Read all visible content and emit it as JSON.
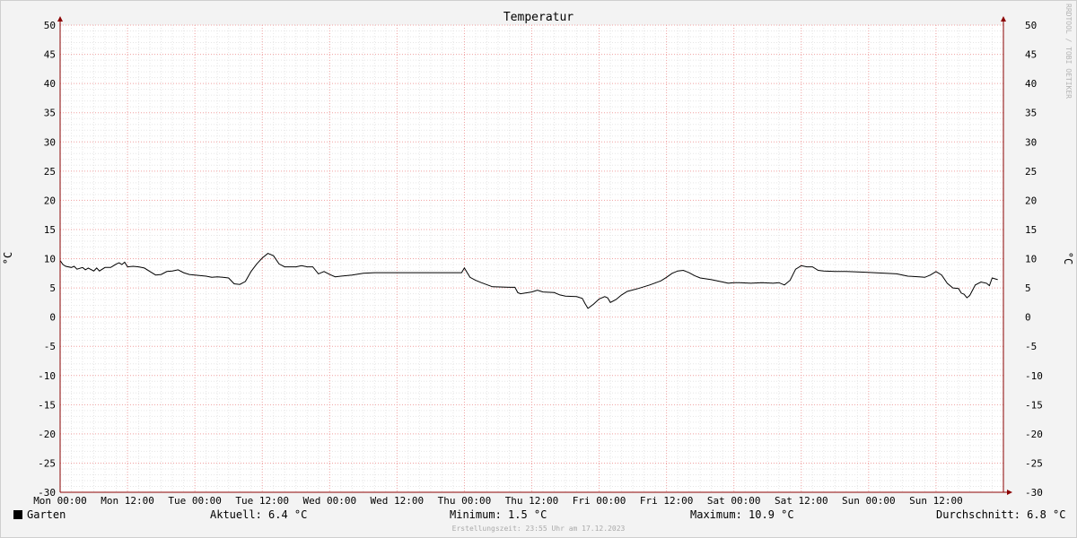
{
  "chart_data": {
    "type": "line",
    "title": "Temperatur",
    "ylabel": "°C",
    "ylabel_right": "°C",
    "ylim": [
      -30,
      50
    ],
    "yticks": [
      50,
      45,
      40,
      35,
      30,
      25,
      20,
      15,
      10,
      5,
      0,
      -5,
      -10,
      -15,
      -20,
      -25,
      -30
    ],
    "xlim_hours": [
      0,
      168
    ],
    "xticks": [
      {
        "label": "Mon 00:00",
        "hour": 0
      },
      {
        "label": "Mon 12:00",
        "hour": 12
      },
      {
        "label": "Tue 00:00",
        "hour": 24
      },
      {
        "label": "Tue 12:00",
        "hour": 36
      },
      {
        "label": "Wed 00:00",
        "hour": 48
      },
      {
        "label": "Wed 12:00",
        "hour": 60
      },
      {
        "label": "Thu 00:00",
        "hour": 72
      },
      {
        "label": "Thu 12:00",
        "hour": 84
      },
      {
        "label": "Fri 00:00",
        "hour": 96
      },
      {
        "label": "Fri 12:00",
        "hour": 108
      },
      {
        "label": "Sat 00:00",
        "hour": 120
      },
      {
        "label": "Sat 12:00",
        "hour": 132
      },
      {
        "label": "Sun 00:00",
        "hour": 144
      },
      {
        "label": "Sun 12:00",
        "hour": 156
      }
    ],
    "series": [
      {
        "name": "Garten",
        "color": "#000000",
        "points": [
          [
            0,
            9.7
          ],
          [
            0.5,
            9.0
          ],
          [
            1,
            8.7
          ],
          [
            2,
            8.5
          ],
          [
            2.5,
            8.7
          ],
          [
            3,
            8.2
          ],
          [
            4,
            8.5
          ],
          [
            4.5,
            8.1
          ],
          [
            5,
            8.4
          ],
          [
            6,
            7.9
          ],
          [
            6.5,
            8.4
          ],
          [
            7,
            7.9
          ],
          [
            8,
            8.5
          ],
          [
            9,
            8.5
          ],
          [
            10,
            9.1
          ],
          [
            10.5,
            9.3
          ],
          [
            11,
            9.0
          ],
          [
            11.5,
            9.4
          ],
          [
            12,
            8.6
          ],
          [
            13,
            8.7
          ],
          [
            14,
            8.6
          ],
          [
            15,
            8.4
          ],
          [
            16,
            7.8
          ],
          [
            17,
            7.2
          ],
          [
            18,
            7.3
          ],
          [
            19,
            7.8
          ],
          [
            20,
            7.9
          ],
          [
            21,
            8.1
          ],
          [
            22,
            7.6
          ],
          [
            23,
            7.3
          ],
          [
            24,
            7.2
          ],
          [
            25,
            7.1
          ],
          [
            26,
            7.0
          ],
          [
            27,
            6.8
          ],
          [
            28,
            6.9
          ],
          [
            29,
            6.8
          ],
          [
            30,
            6.7
          ],
          [
            31,
            5.7
          ],
          [
            32,
            5.6
          ],
          [
            33,
            6.1
          ],
          [
            34,
            7.8
          ],
          [
            35,
            9.1
          ],
          [
            36,
            10.1
          ],
          [
            37,
            10.9
          ],
          [
            38,
            10.5
          ],
          [
            39,
            9.1
          ],
          [
            40,
            8.6
          ],
          [
            42,
            8.6
          ],
          [
            43,
            8.8
          ],
          [
            44,
            8.6
          ],
          [
            45,
            8.6
          ],
          [
            46,
            7.4
          ],
          [
            47,
            7.8
          ],
          [
            48,
            7.3
          ],
          [
            49,
            6.9
          ],
          [
            50,
            7.0
          ],
          [
            52,
            7.2
          ],
          [
            54,
            7.5
          ],
          [
            56,
            7.6
          ],
          [
            60,
            7.6
          ],
          [
            64,
            7.6
          ],
          [
            70,
            7.6
          ],
          [
            71.5,
            7.6
          ],
          [
            72,
            8.4
          ],
          [
            73,
            6.8
          ],
          [
            74,
            6.3
          ],
          [
            75,
            5.9
          ],
          [
            77,
            5.2
          ],
          [
            80,
            5.1
          ],
          [
            81,
            5.1
          ],
          [
            81.5,
            4.2
          ],
          [
            82,
            4.0
          ],
          [
            84,
            4.3
          ],
          [
            85,
            4.6
          ],
          [
            86,
            4.3
          ],
          [
            88,
            4.2
          ],
          [
            89,
            3.8
          ],
          [
            90,
            3.6
          ],
          [
            92,
            3.5
          ],
          [
            93,
            3.2
          ],
          [
            93.5,
            2.3
          ],
          [
            94,
            1.5
          ],
          [
            95,
            2.2
          ],
          [
            96,
            3.1
          ],
          [
            97,
            3.5
          ],
          [
            97.5,
            3.3
          ],
          [
            98,
            2.5
          ],
          [
            99,
            3.0
          ],
          [
            100,
            3.8
          ],
          [
            101,
            4.4
          ],
          [
            103,
            4.9
          ],
          [
            105,
            5.5
          ],
          [
            107,
            6.2
          ],
          [
            108,
            6.8
          ],
          [
            109,
            7.5
          ],
          [
            110,
            7.9
          ],
          [
            111,
            8.0
          ],
          [
            112,
            7.6
          ],
          [
            113,
            7.1
          ],
          [
            114,
            6.7
          ],
          [
            116,
            6.4
          ],
          [
            118,
            6.0
          ],
          [
            119,
            5.8
          ],
          [
            120,
            5.9
          ],
          [
            121,
            5.9
          ],
          [
            123,
            5.8
          ],
          [
            125,
            5.9
          ],
          [
            127,
            5.8
          ],
          [
            128,
            5.9
          ],
          [
            129,
            5.5
          ],
          [
            130,
            6.3
          ],
          [
            131,
            8.2
          ],
          [
            132,
            8.8
          ],
          [
            133,
            8.6
          ],
          [
            134,
            8.6
          ],
          [
            135,
            8.0
          ],
          [
            136,
            7.9
          ],
          [
            138,
            7.8
          ],
          [
            140,
            7.8
          ],
          [
            143,
            7.7
          ],
          [
            145,
            7.6
          ],
          [
            147,
            7.5
          ],
          [
            149,
            7.4
          ],
          [
            151,
            7.0
          ],
          [
            153,
            6.9
          ],
          [
            154,
            6.8
          ],
          [
            155,
            7.2
          ],
          [
            156,
            7.8
          ],
          [
            157,
            7.2
          ],
          [
            158,
            5.8
          ],
          [
            159,
            5.0
          ],
          [
            160,
            4.9
          ],
          [
            160.5,
            4.1
          ],
          [
            161,
            3.9
          ],
          [
            161.5,
            3.3
          ],
          [
            162,
            3.7
          ],
          [
            163,
            5.5
          ],
          [
            164,
            6.0
          ],
          [
            165,
            5.8
          ],
          [
            165.5,
            5.4
          ],
          [
            166,
            6.7
          ],
          [
            167,
            6.4
          ]
        ]
      }
    ],
    "grid": true,
    "legend": "bottom-left"
  },
  "legend": {
    "series_label": "Garten",
    "current": "Aktuell: 6.4 °C",
    "minimum": "Minimum: 1.5 °C",
    "maximum": "Maximum: 10.9 °C",
    "average": "Durchschnitt: 6.8 °C"
  },
  "watermark": "RRDTOOL / TOBI OETIKER",
  "footer": "Erstellungszeit: 23:55 Uhr am 17.12.2023"
}
